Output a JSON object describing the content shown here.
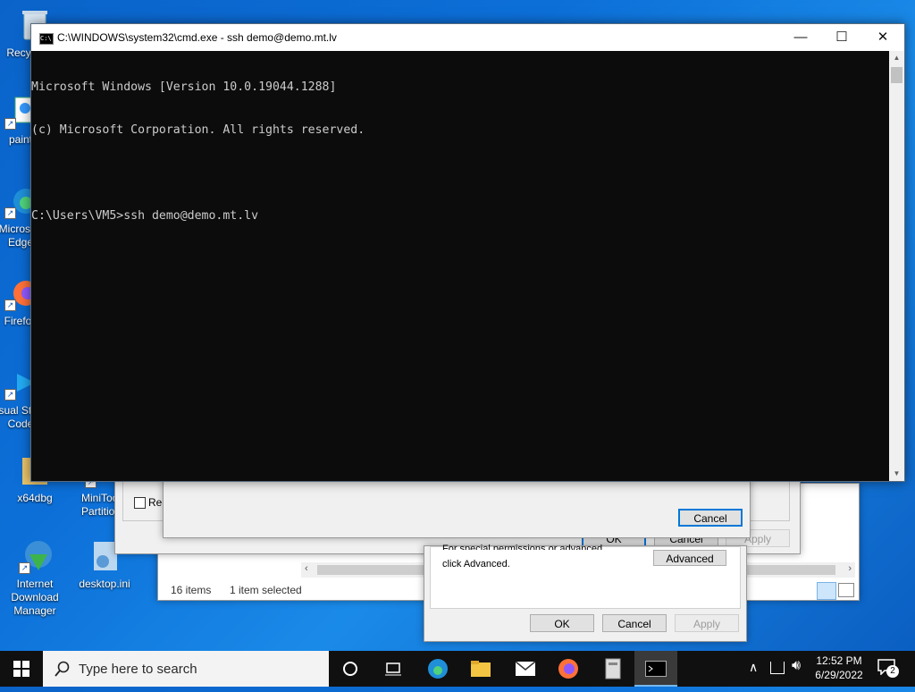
{
  "desktop": {
    "icons": [
      {
        "label": "Recycle Bin"
      },
      {
        "label": "paint"
      },
      {
        "label": "Microsoft Edge"
      },
      {
        "label": "Firefox"
      },
      {
        "label": "Visual Studio Code"
      },
      {
        "label": "x64dbg"
      },
      {
        "label": "MiniTool Partition"
      },
      {
        "label": "Internet Download Manager"
      },
      {
        "label": "desktop.ini"
      }
    ]
  },
  "cmd_window": {
    "title": "C:\\WINDOWS\\system32\\cmd.exe - ssh  demo@demo.mt.lv",
    "lines": [
      "Microsoft Windows [Version 10.0.19044.1288]",
      "(c) Microsoft Corporation. All rights reserved.",
      "",
      "C:\\Users\\VM5>ssh demo@demo.mt.lv"
    ],
    "minimize_glyph": "—",
    "maximize_glyph": "☐",
    "close_glyph": "✕"
  },
  "explorer": {
    "status_items": "16 items",
    "status_selected": "1 item selected"
  },
  "properties_dialog": {
    "checkbox_label": "Rep",
    "ok": "OK",
    "cancel": "Cancel",
    "apply": "Apply"
  },
  "inner_dialog": {
    "cancel": "Cancel"
  },
  "security_dialog": {
    "text_line1": "For special permissions or advanced settings,",
    "text_line2": "click Advanced.",
    "advanced": "Advanced",
    "ok": "OK",
    "cancel": "Cancel",
    "apply": "Apply"
  },
  "taskbar": {
    "search_placeholder": "Type here to search",
    "time": "12:52 PM",
    "date": "6/29/2022",
    "notification_count": "2"
  }
}
